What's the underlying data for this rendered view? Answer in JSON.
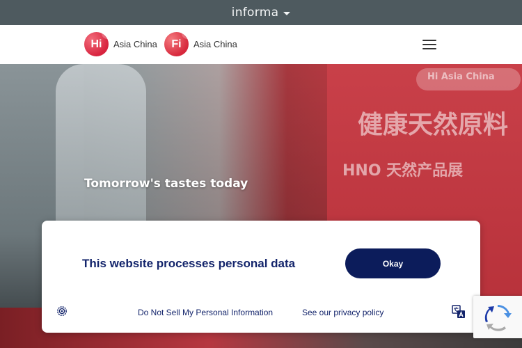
{
  "topbar": {
    "brand": "informa"
  },
  "nav": {
    "logos": [
      {
        "mark": "Hi",
        "label": "Asia China"
      },
      {
        "mark": "Fi",
        "label": "Asia China"
      }
    ]
  },
  "hero": {
    "title": "Tomorrow's tastes today",
    "sign_text": "Hi Asia China",
    "banner_text": "健康天然原料",
    "booth_text": "HNO 天然产品展"
  },
  "consent": {
    "title": "This website processes personal data",
    "okay_label": "Okay",
    "do_not_sell_label": "Do Not Sell My Personal Information",
    "privacy_label": "See our privacy policy"
  },
  "colors": {
    "topbar": "#4e5a5f",
    "brand_navy": "#13246b",
    "button_navy": "#0c1c5b",
    "logo_red": "#d8243f"
  },
  "icons": {
    "brand_caret": "chevron-down-icon",
    "menu": "hamburger-menu-icon",
    "consent_settings": "settings-icon",
    "language": "translate-icon",
    "recaptcha": "recaptcha-icon"
  }
}
